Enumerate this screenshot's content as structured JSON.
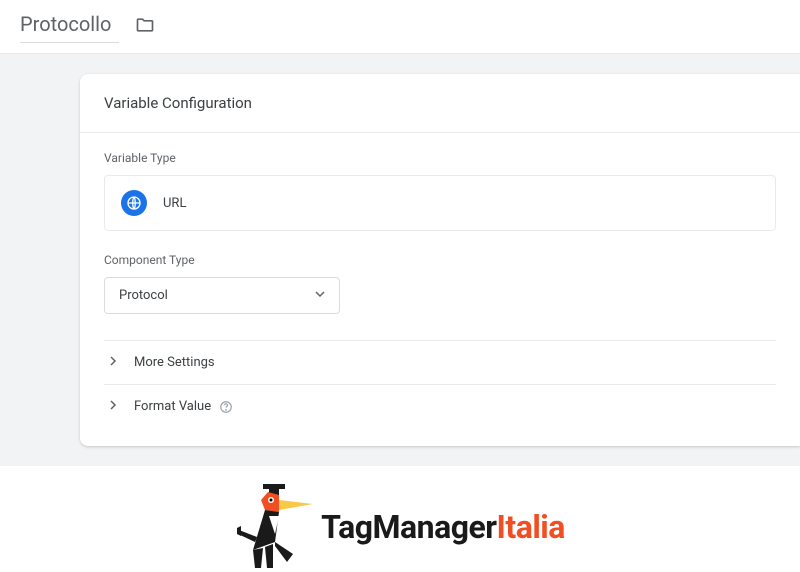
{
  "header": {
    "title": "Protocollo"
  },
  "card": {
    "heading": "Variable Configuration",
    "variableTypeLabel": "Variable Type",
    "variableTypeName": "URL",
    "componentTypeLabel": "Component Type",
    "componentTypeValue": "Protocol",
    "moreSettings": "More Settings",
    "formatValue": "Format Value"
  },
  "logo": {
    "part1": "TagManager",
    "part2": "Italia"
  }
}
